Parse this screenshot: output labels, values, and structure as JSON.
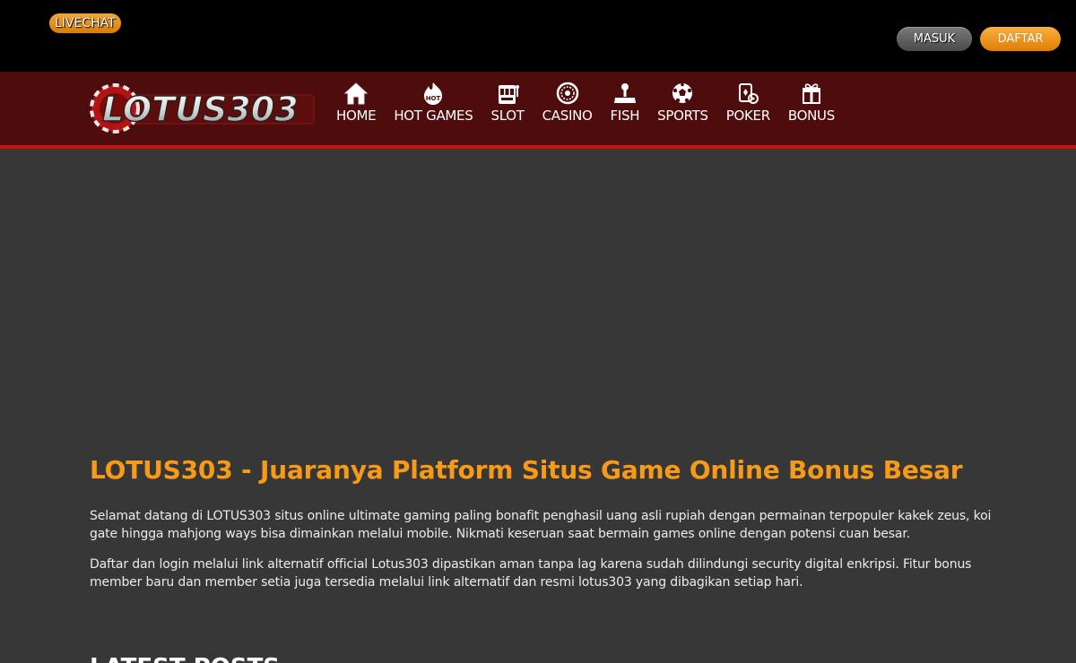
{
  "topbar": {
    "livechat_label": "LIVECHAT",
    "masuk_label": "MASUK",
    "daftar_label": "DAFTAR"
  },
  "brand": {
    "logo_text": "LOTUS303",
    "accent_color": "#f79a17",
    "nav_bg": "#4f0c0c",
    "nav_border": "#c8130d"
  },
  "nav": {
    "items": [
      {
        "label": "HOME",
        "icon": "home-icon"
      },
      {
        "label": "HOT GAMES",
        "icon": "hot-games-icon"
      },
      {
        "label": "SLOT",
        "icon": "slot-machine-icon"
      },
      {
        "label": "CASINO",
        "icon": "roulette-icon"
      },
      {
        "label": "FISH",
        "icon": "joystick-icon"
      },
      {
        "label": "SPORTS",
        "icon": "soccer-ball-icon"
      },
      {
        "label": "POKER",
        "icon": "poker-cards-icon"
      },
      {
        "label": "BONUS",
        "icon": "gift-icon"
      }
    ]
  },
  "main": {
    "headline": "LOTUS303 - Juaranya Platform Situs Game Online Bonus Besar",
    "paragraphs": [
      "Selamat datang di LOTUS303 situs online ultimate gaming paling bonafit penghasil uang asli rupiah dengan permainan terpopuler kakek zeus, koi gate hingga mahjong ways bisa dimainkan melalui mobile. Nikmati keseruan saat bermain games online dengan potensi cuan besar.",
      "Daftar dan login melalui link alternatif official Lotus303 dipastikan aman tanpa lag karena sudah dilindungi security digital enkripsi. Fitur bonus member baru dan member setia juga tersedia melalui link alternatif dan resmi lotus303 yang dibagikan setiap hari."
    ],
    "latest_posts_heading": "LATEST POSTS"
  }
}
